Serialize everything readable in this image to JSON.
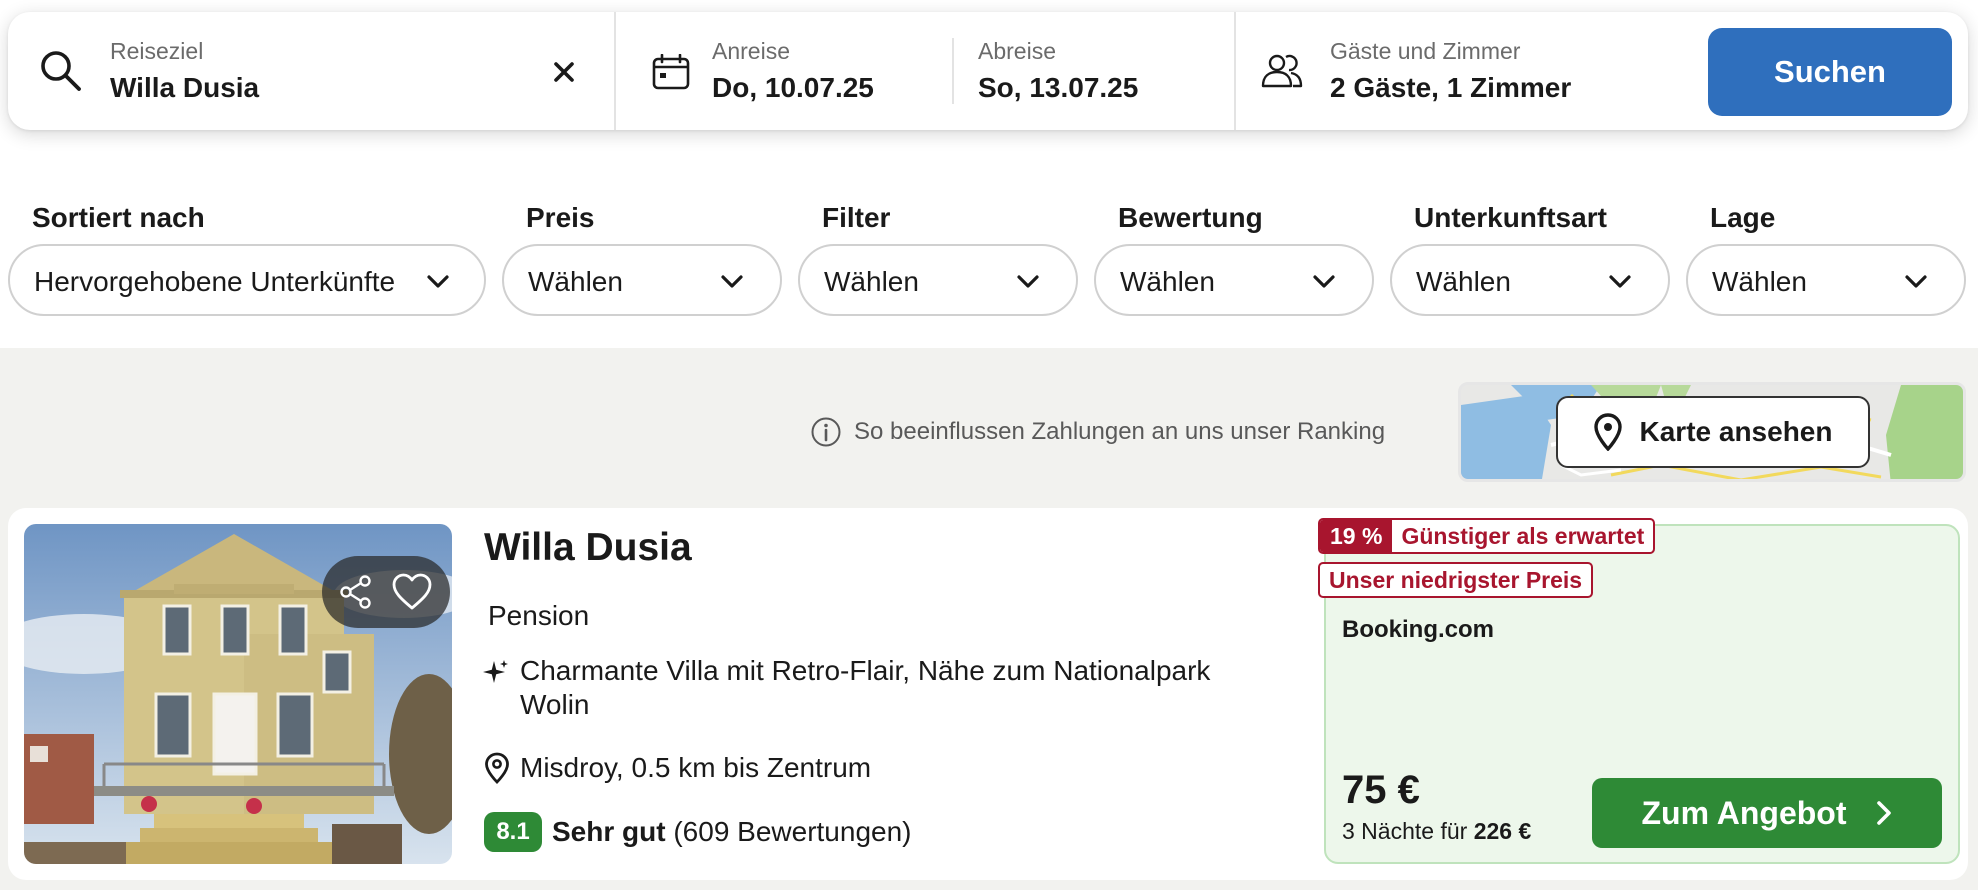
{
  "search": {
    "destination_label": "Reiseziel",
    "destination_value": "Willa Dusia",
    "checkin_label": "Anreise",
    "checkin_value": "Do, 10.07.25",
    "checkout_label": "Abreise",
    "checkout_value": "So, 13.07.25",
    "guests_label": "Gäste und Zimmer",
    "guests_value": "2 Gäste, 1 Zimmer",
    "search_button": "Suchen"
  },
  "filters": [
    {
      "label": "Sortiert nach",
      "value": "Hervorgehobene Unterkünfte"
    },
    {
      "label": "Preis",
      "value": "Wählen"
    },
    {
      "label": "Filter",
      "value": "Wählen"
    },
    {
      "label": "Bewertung",
      "value": "Wählen"
    },
    {
      "label": "Unterkunftsart",
      "value": "Wählen"
    },
    {
      "label": "Lage",
      "value": "Wählen"
    }
  ],
  "ranking_note": "So beeinflussen Zahlungen an uns unser Ranking",
  "map_button": "Karte ansehen",
  "listing": {
    "name": "Willa Dusia",
    "type": "Pension",
    "feature": "Charmante Villa mit Retro-Flair, Nähe zum Nationalpark Wolin",
    "location": "Misdroy, 0.5 km bis Zentrum",
    "rating_score": "8.1",
    "rating_text": "Sehr gut",
    "rating_count": "(609 Bewertungen)",
    "deal_percent": "19 %",
    "deal_text": "Günstiger als erwartet",
    "lowest_price_badge": "Unser niedrigster Preis",
    "provider": "Booking.com",
    "price": "75 €",
    "nights_prefix": "3 Nächte für",
    "total_price": "226 €",
    "cta": "Zum Angebot"
  },
  "colors": {
    "primary_blue": "#2f6fbd",
    "deal_green": "#2e8a36",
    "offer_bg": "#edf7eb",
    "badge_red": "#a8152e",
    "results_bg": "#f2f2ef"
  }
}
